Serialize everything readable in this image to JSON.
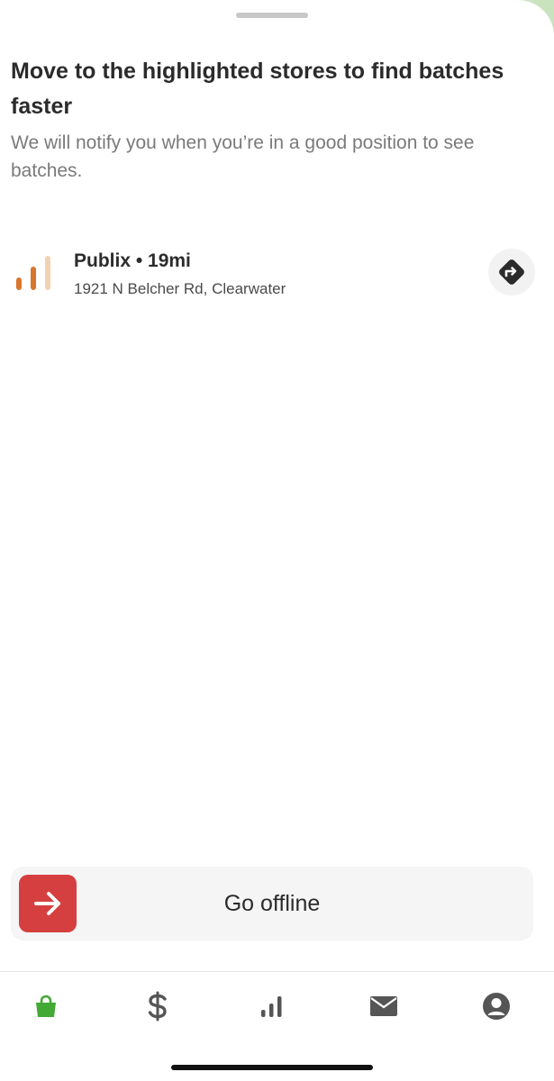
{
  "sheet": {
    "heading": "Move to the highlighted stores to find batches faster",
    "subheading": "We will notify you when you’re in a good position to see batches."
  },
  "store": {
    "name_distance": "Publix • 19mi",
    "address": "1921 N Belcher Rd, Clearwater",
    "signal_icon": "signal-strength-icon",
    "signal_level_bars": 2,
    "signal_total_bars": 3,
    "directions_icon": "directions-icon"
  },
  "go_offline": {
    "label": "Go offline",
    "icon": "arrow-right-icon",
    "icon_bg": "#d63f3f"
  },
  "tabbar": {
    "tabs": [
      {
        "icon": "shopping-bag-icon",
        "active": true,
        "color": "#43a935"
      },
      {
        "icon": "dollar-icon",
        "active": false,
        "color": "#555555"
      },
      {
        "icon": "stats-icon",
        "active": false,
        "color": "#555555"
      },
      {
        "icon": "mail-icon",
        "active": false,
        "color": "#555555"
      },
      {
        "icon": "account-icon",
        "active": false,
        "color": "#555555"
      }
    ]
  },
  "colors": {
    "signal_active": "#d9762b",
    "signal_inactive": "#f2d2b3",
    "accent_green": "#43a935"
  }
}
